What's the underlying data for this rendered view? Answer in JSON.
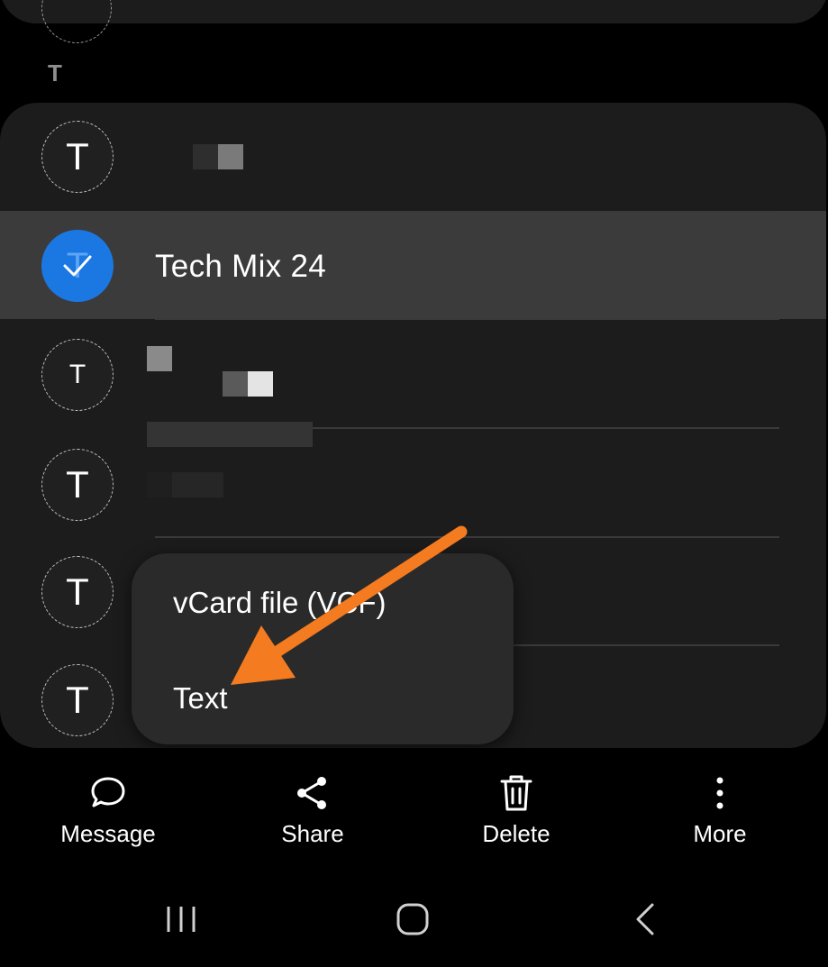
{
  "section": {
    "letter": "T"
  },
  "contacts": [
    {
      "avatar_letter": "T",
      "name": "",
      "selected": false
    },
    {
      "avatar_letter": "T",
      "name": "Tech Mix 24",
      "selected": true
    },
    {
      "avatar_letter": "T",
      "name": "",
      "selected": false
    },
    {
      "avatar_letter": "T",
      "name": "",
      "selected": false
    },
    {
      "avatar_letter": "T",
      "name": "",
      "selected": false
    },
    {
      "avatar_letter": "T",
      "name": "",
      "selected": false
    }
  ],
  "share_menu": {
    "items": [
      {
        "label": "vCard file (VCF)"
      },
      {
        "label": "Text"
      }
    ]
  },
  "actions": [
    {
      "label": "Message",
      "icon": "message-bubble-icon"
    },
    {
      "label": "Share",
      "icon": "share-icon"
    },
    {
      "label": "Delete",
      "icon": "trash-icon"
    },
    {
      "label": "More",
      "icon": "more-vertical-icon"
    }
  ],
  "colors": {
    "accent": "#1b78e3",
    "annotation_arrow": "#f47b20",
    "card": "#1c1c1c",
    "selected_row": "#3b3b3b"
  }
}
